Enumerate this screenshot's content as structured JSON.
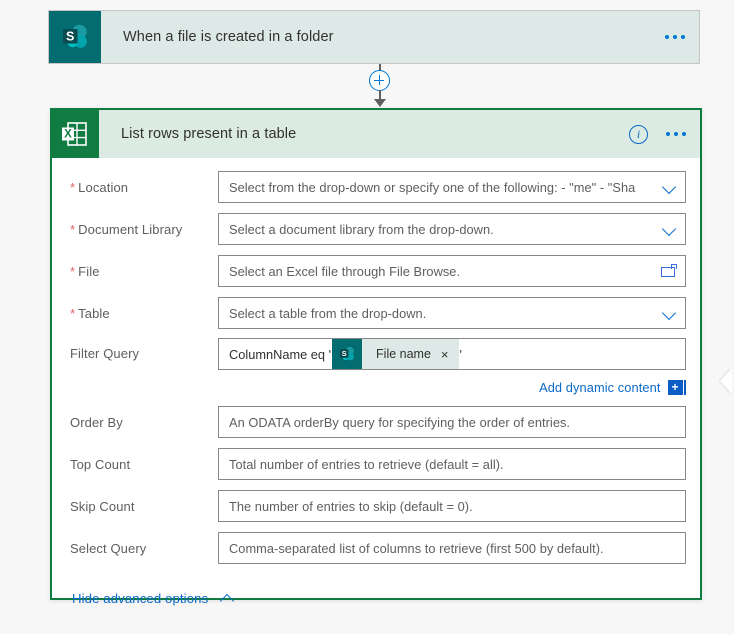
{
  "trigger": {
    "title": "When a file is created in a folder",
    "icon": "sharepoint-icon",
    "icon_letter": "S",
    "more_label": "•••"
  },
  "connector": {
    "add_step_label": "+"
  },
  "action": {
    "title": "List rows present in a table",
    "icon": "excel-icon",
    "icon_letter": "X",
    "info_label": "i",
    "more_label": "•••",
    "fields": [
      {
        "label": "Location",
        "required": true,
        "placeholder": "Select from the drop-down or specify one of the following: - \"me\" - \"Sha",
        "control": "dropdown"
      },
      {
        "label": "Document Library",
        "required": true,
        "placeholder": "Select a document library from the drop-down.",
        "control": "dropdown"
      },
      {
        "label": "File",
        "required": true,
        "placeholder": "Select an Excel file through File Browse.",
        "control": "filepicker"
      },
      {
        "label": "Table",
        "required": true,
        "placeholder": "Select a table from the drop-down.",
        "control": "dropdown"
      }
    ],
    "filter_query": {
      "label": "Filter Query",
      "required": false,
      "prefix_text": "ColumnName eq '",
      "suffix_text": "'",
      "token": {
        "label": "File name",
        "icon": "sharepoint-icon",
        "icon_letter": "S",
        "remove_label": "×"
      }
    },
    "add_dynamic_content": {
      "label": "Add dynamic content",
      "plus_label": "+"
    },
    "advanced_fields": [
      {
        "label": "Order By",
        "required": false,
        "placeholder": "An ODATA orderBy query for specifying the order of entries.",
        "control": "text"
      },
      {
        "label": "Top Count",
        "required": false,
        "placeholder": "Total number of entries to retrieve (default = all).",
        "control": "text"
      },
      {
        "label": "Skip Count",
        "required": false,
        "placeholder": "The number of entries to skip (default = 0).",
        "control": "text"
      },
      {
        "label": "Select Query",
        "required": false,
        "placeholder": "Comma-separated list of columns to retrieve (first 500 by default).",
        "control": "text"
      }
    ],
    "advanced_toggle": {
      "label": "Hide advanced options"
    }
  },
  "colors": {
    "excel_green": "#107c41",
    "excel_header_bg": "#dbeae2",
    "sharepoint_teal": "#036c70",
    "sharepoint_header_bg": "#dce9e6",
    "link_blue": "#0b6ac9",
    "required_red": "#e06666",
    "canvas_bg": "#f7f7f7"
  }
}
